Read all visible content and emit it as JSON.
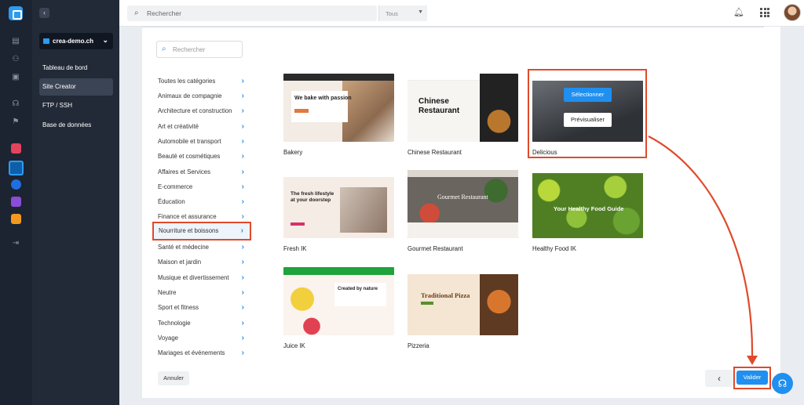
{
  "topbar": {
    "search_placeholder": "Rechercher",
    "scope": "Tous"
  },
  "sidebar": {
    "site": "crea-demo.ch",
    "items": [
      {
        "label": "Tableau de bord"
      },
      {
        "label": "Site Creator"
      },
      {
        "label": "FTP / SSH"
      },
      {
        "label": "Base de données"
      }
    ]
  },
  "panel": {
    "search_placeholder": "Rechercher",
    "categories": [
      {
        "label": "Toutes les catégories"
      },
      {
        "label": "Animaux de compagnie"
      },
      {
        "label": "Architecture et construction"
      },
      {
        "label": "Art et créativité"
      },
      {
        "label": "Automobile et transport"
      },
      {
        "label": "Beauté et cosmétiques"
      },
      {
        "label": "Affaires et Services"
      },
      {
        "label": "E-commerce"
      },
      {
        "label": "Éducation"
      },
      {
        "label": "Finance et assurance"
      },
      {
        "label": "Nourriture et boissons"
      },
      {
        "label": "Santé et médecine"
      },
      {
        "label": "Maison et jardin"
      },
      {
        "label": "Musique et divertissement"
      },
      {
        "label": "Neutre"
      },
      {
        "label": "Sport et fitness"
      },
      {
        "label": "Technologie"
      },
      {
        "label": "Voyage"
      },
      {
        "label": "Mariages et événements"
      }
    ],
    "templates": [
      {
        "name": "Bakery",
        "headline": "We bake with passion"
      },
      {
        "name": "Chinese Restaurant",
        "headline": "Chinese Restaurant"
      },
      {
        "name": "Delicious",
        "select_label": "Sélectionner",
        "preview_label": "Prévisualiser"
      },
      {
        "name": "Fresh IK",
        "headline": "The fresh lifestyle at your doorstep"
      },
      {
        "name": "Gourmet Restaurant",
        "headline": "Gourmet Restaurant"
      },
      {
        "name": "Healthy Food IK",
        "headline": "Your Healthy Food Guide"
      },
      {
        "name": "Juice IK",
        "headline": "Created by nature"
      },
      {
        "name": "Pizzeria",
        "headline": "Traditional Pizza"
      }
    ],
    "cancel_label": "Annuler",
    "back_label": "‹",
    "validate_label": "Valider"
  }
}
